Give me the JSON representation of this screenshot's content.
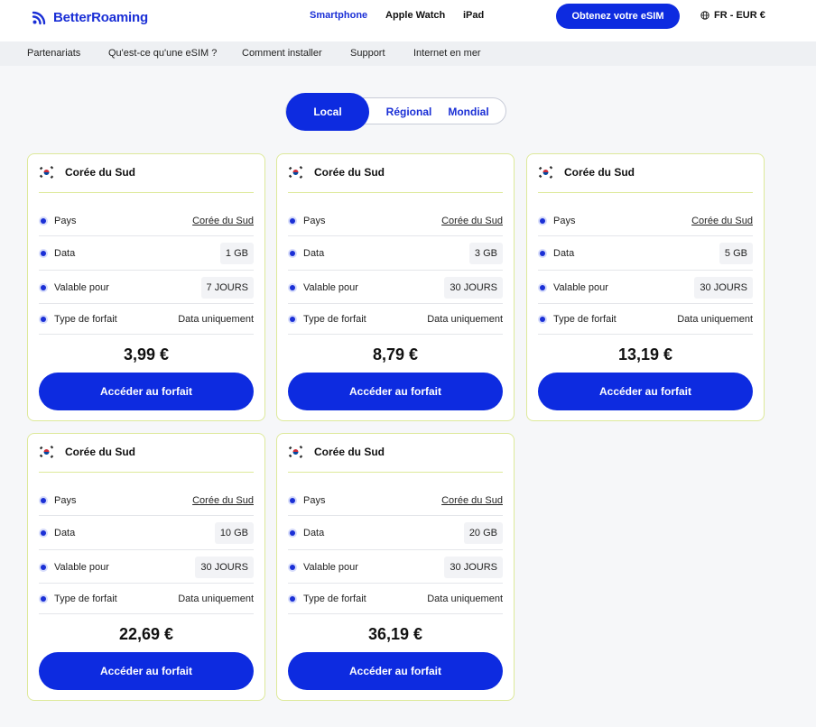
{
  "header": {
    "logo_text": "BetterRoaming",
    "nav": [
      "Smartphone",
      "Apple Watch",
      "iPad"
    ],
    "cta_label": "Obtenez votre eSIM",
    "locale": "FR - EUR €"
  },
  "subnav": [
    "Partenariats",
    "Qu'est-ce qu'une eSIM ?",
    "Comment installer",
    "Support",
    "Internet en mer"
  ],
  "toggle": [
    "Local",
    "Régional",
    "Mondial"
  ],
  "labels": {
    "country": "Pays",
    "data": "Data",
    "validity": "Valable pour",
    "plan_type": "Type de forfait",
    "button": "Accéder au forfait"
  },
  "plans": [
    {
      "title": "Corée du Sud",
      "country": "Corée du Sud",
      "data": "1 GB",
      "validity": "7 JOURS",
      "type": "Data uniquement",
      "price": "3,99 €"
    },
    {
      "title": "Corée du Sud",
      "country": "Corée du Sud",
      "data": "3 GB",
      "validity": "30 JOURS",
      "type": "Data uniquement",
      "price": "8,79 €"
    },
    {
      "title": "Corée du Sud",
      "country": "Corée du Sud",
      "data": "5 GB",
      "validity": "30 JOURS",
      "type": "Data uniquement",
      "price": "13,19 €"
    },
    {
      "title": "Corée du Sud",
      "country": "Corée du Sud",
      "data": "10 GB",
      "validity": "30 JOURS",
      "type": "Data uniquement",
      "price": "22,69 €"
    },
    {
      "title": "Corée du Sud",
      "country": "Corée du Sud",
      "data": "20 GB",
      "validity": "30 JOURS",
      "type": "Data uniquement",
      "price": "36,19 €"
    }
  ],
  "colors": {
    "brand": "#0d2be0",
    "card_border": "#dde99a"
  }
}
